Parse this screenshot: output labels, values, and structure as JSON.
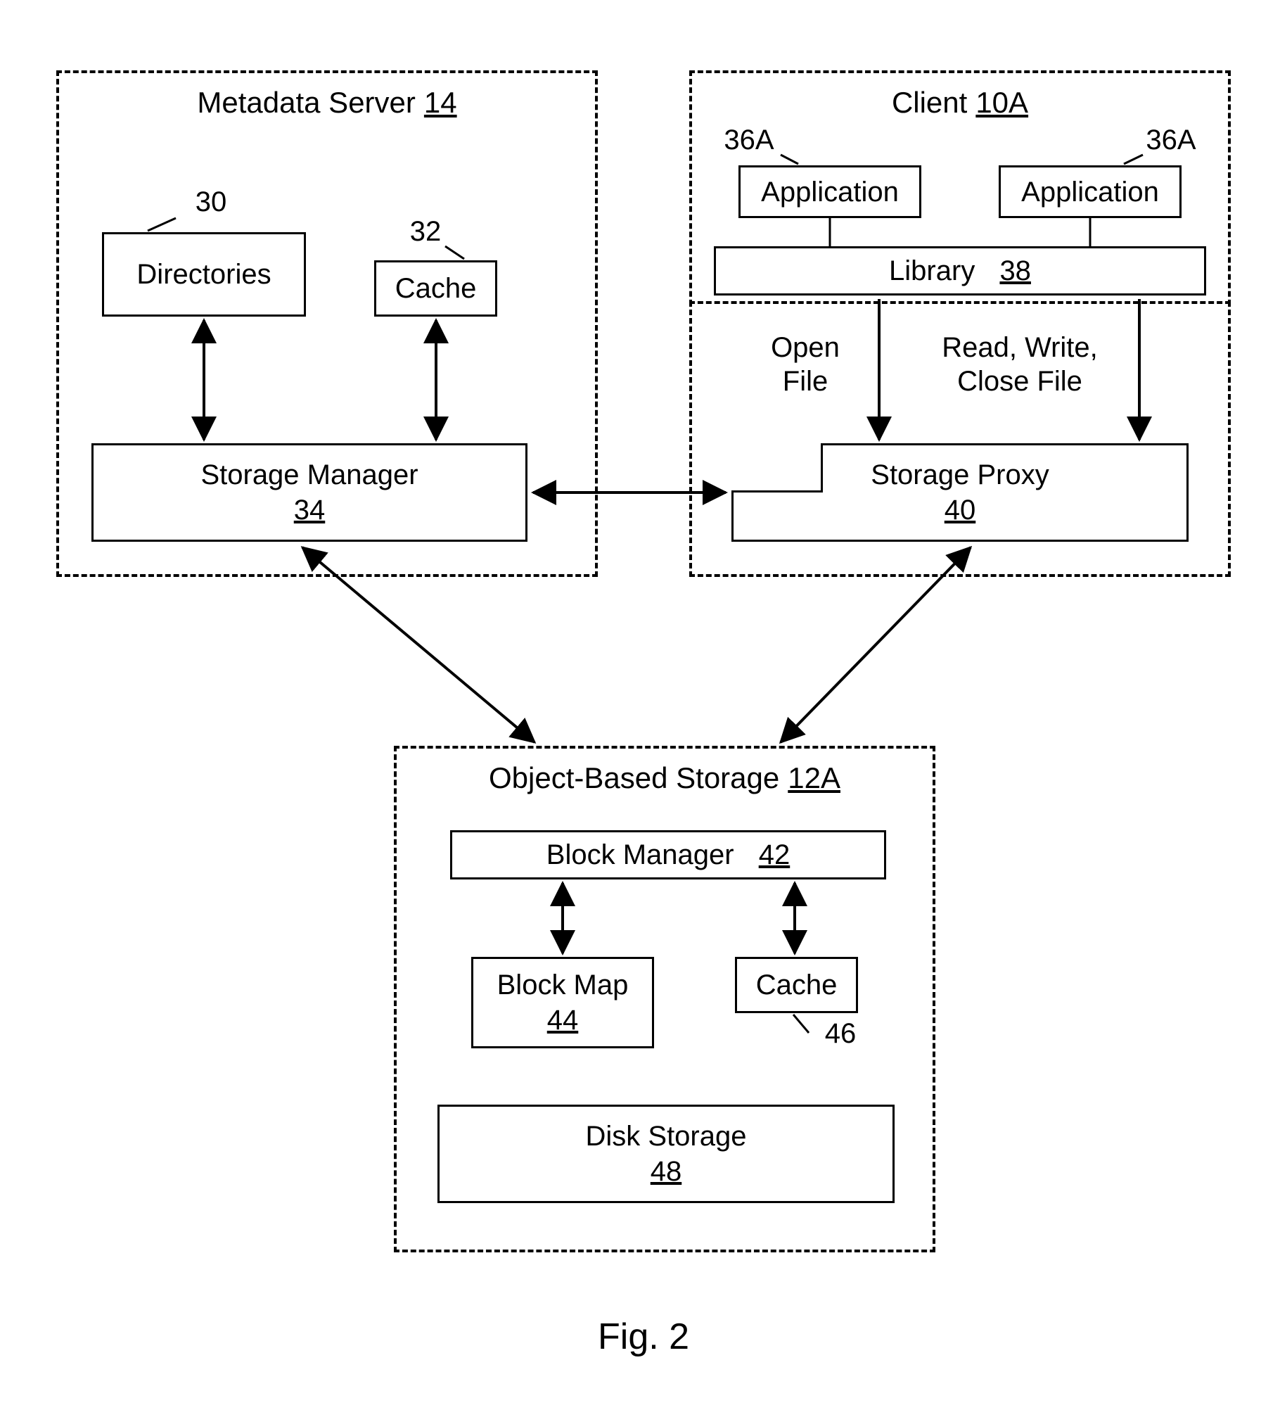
{
  "metadata_server": {
    "title": "Metadata Server",
    "ref": "14",
    "directories": {
      "label": "Directories",
      "ref": "30"
    },
    "cache": {
      "label": "Cache",
      "ref": "32"
    },
    "storage_manager": {
      "label": "Storage Manager",
      "ref": "34"
    }
  },
  "client": {
    "title": "Client",
    "ref": "10A",
    "app_left": {
      "label": "Application",
      "ref": "36A"
    },
    "app_right": {
      "label": "Application",
      "ref": "36A"
    },
    "library": {
      "label": "Library",
      "ref": "38"
    },
    "edge_open": "Open\nFile",
    "edge_rwc": "Read, Write,\nClose File",
    "storage_proxy": {
      "label": "Storage Proxy",
      "ref": "40"
    }
  },
  "obs": {
    "title": "Object-Based Storage",
    "ref": "12A",
    "block_manager": {
      "label": "Block Manager",
      "ref": "42"
    },
    "block_map": {
      "label": "Block Map",
      "ref": "44"
    },
    "cache": {
      "label": "Cache",
      "ref": "46"
    },
    "disk_storage": {
      "label": "Disk Storage",
      "ref": "48"
    }
  },
  "figure_caption": "Fig. 2"
}
